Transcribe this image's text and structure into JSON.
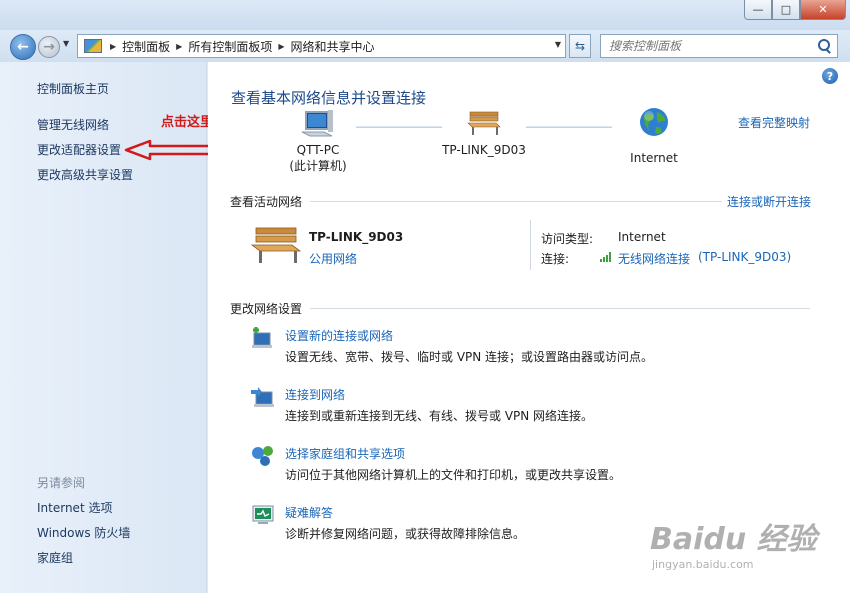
{
  "window": {
    "min_glyph": "—",
    "max_glyph": "□",
    "close_glyph": "✕"
  },
  "address_bar": {
    "breadcrumbs": [
      "控制面板",
      "所有控制面板项",
      "网络和共享中心"
    ],
    "search_placeholder": "搜索控制面板"
  },
  "sidebar": {
    "home": "控制面板主页",
    "links": [
      "管理无线网络",
      "更改适配器设置",
      "更改高级共享设置"
    ],
    "see_also_label": "另请参阅",
    "see_also": [
      "Internet 选项",
      "Windows 防火墙",
      "家庭组"
    ]
  },
  "annotation": {
    "text": "点击这里",
    "color": "#d11a1a"
  },
  "main": {
    "title": "查看基本网络信息并设置连接",
    "full_map_link": "查看完整映射",
    "network_map": {
      "computer_name": "QTT-PC",
      "computer_sub": "(此计算机)",
      "router_name": "TP-LINK_9D03",
      "internet_name": "Internet"
    },
    "active": {
      "label": "查看活动网络",
      "connect_link": "连接或断开连接",
      "network_name": "TP-LINK_9D03",
      "network_type": "公用网络",
      "access_type_key": "访问类型:",
      "access_type_value": "Internet",
      "connection_key": "连接:",
      "connection_value": "无线网络连接",
      "connection_ssid": "(TP-LINK_9D03)"
    },
    "change_settings": {
      "label": "更改网络设置",
      "tasks": [
        {
          "title": "设置新的连接或网络",
          "desc": "设置无线、宽带、拨号、临时或 VPN 连接；或设置路由器或访问点。"
        },
        {
          "title": "连接到网络",
          "desc": "连接到或重新连接到无线、有线、拨号或 VPN 网络连接。"
        },
        {
          "title": "选择家庭组和共享选项",
          "desc": "访问位于其他网络计算机上的文件和打印机，或更改共享设置。"
        },
        {
          "title": "疑难解答",
          "desc": "诊断并修复网络问题，或获得故障排除信息。"
        }
      ]
    }
  },
  "watermark": {
    "main": "Baidu 经验",
    "sub": "jingyan.baidu.com"
  },
  "icons": {
    "back": "back-arrow-icon",
    "forward": "forward-arrow-icon",
    "search": "search-icon",
    "help": "help-icon",
    "computer": "computer-icon",
    "router": "bench-network-icon",
    "internet": "globe-icon"
  },
  "colors": {
    "link": "#1a66b8",
    "title": "#1d4a8a",
    "sidebar_bg": "#e4eef9"
  }
}
